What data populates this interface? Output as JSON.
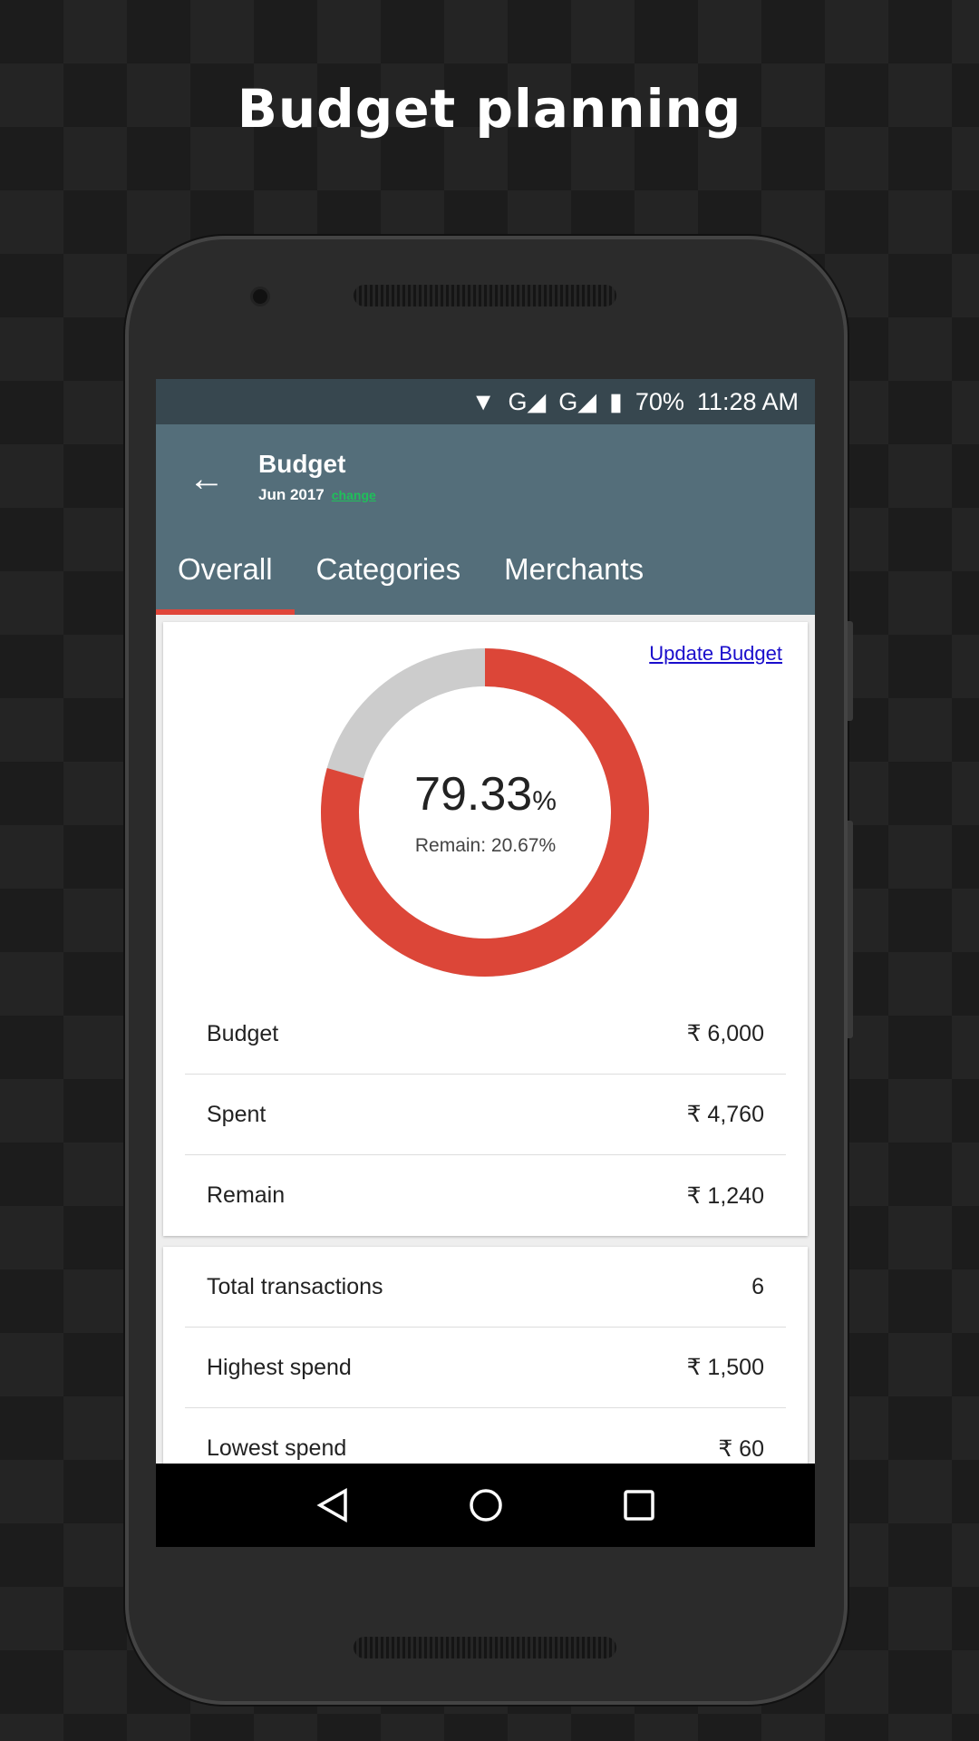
{
  "headline": "Budget planning",
  "status": {
    "battery": "70%",
    "time": "11:28 AM",
    "network": "G"
  },
  "appbar": {
    "title": "Budget",
    "month": "Jun 2017",
    "change_label": "change"
  },
  "tabs": [
    {
      "label": "Overall",
      "active": true
    },
    {
      "label": "Categories"
    },
    {
      "label": "Merchants"
    }
  ],
  "overview": {
    "update_label": "Update Budget",
    "spent_percent": "79.33",
    "percent_sign": "%",
    "remain_text": "Remain: 20.67%",
    "spent_fraction": 0.7933,
    "colors": {
      "spent": "#dc4638",
      "remain": "#cccccc"
    },
    "rows": [
      {
        "label": "Budget",
        "value": "₹ 6,000"
      },
      {
        "label": "Spent",
        "value": "₹ 4,760"
      },
      {
        "label": "Remain",
        "value": "₹ 1,240"
      }
    ]
  },
  "stats": [
    {
      "label": "Total transactions",
      "value": "6"
    },
    {
      "label": "Highest spend",
      "value": "₹ 1,500"
    },
    {
      "label": "Lowest spend",
      "value": "₹ 60"
    }
  ]
}
